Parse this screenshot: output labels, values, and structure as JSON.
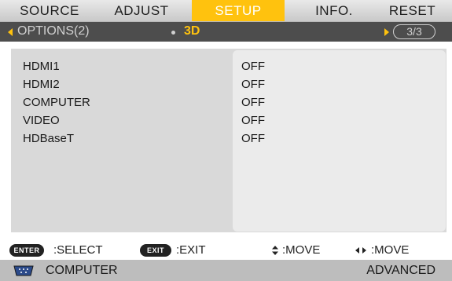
{
  "tabs": [
    {
      "label": "SOURCE",
      "active": false
    },
    {
      "label": "ADJUST",
      "active": false
    },
    {
      "label": "SETUP",
      "active": true
    },
    {
      "label": "INFO.",
      "active": false
    },
    {
      "label": "RESET",
      "active": false
    }
  ],
  "subheader": {
    "options_label": "OPTIONS(2)",
    "page_title": "3D",
    "page_indicator": "3/3"
  },
  "rows": [
    {
      "label": "HDMI1",
      "value": "OFF"
    },
    {
      "label": "HDMI2",
      "value": "OFF"
    },
    {
      "label": "COMPUTER",
      "value": "OFF"
    },
    {
      "label": "VIDEO",
      "value": "OFF"
    },
    {
      "label": "HDBaseT",
      "value": "OFF"
    }
  ],
  "help": {
    "enter_key": "ENTER",
    "enter_text": ":SELECT",
    "exit_key": "EXIT",
    "exit_text": ":EXIT",
    "move_vertical": ":MOVE",
    "move_horizontal": ":MOVE"
  },
  "status": {
    "source_icon": "computer-port-icon",
    "source": "COMPUTER",
    "mode": "ADVANCED"
  },
  "colors": {
    "accent": "#ffc20e",
    "subbar_bg": "#4d4d4d",
    "content_bg": "#d9d9d9",
    "panel_bg": "#ebebeb",
    "status_bg": "#bdbdbd"
  }
}
